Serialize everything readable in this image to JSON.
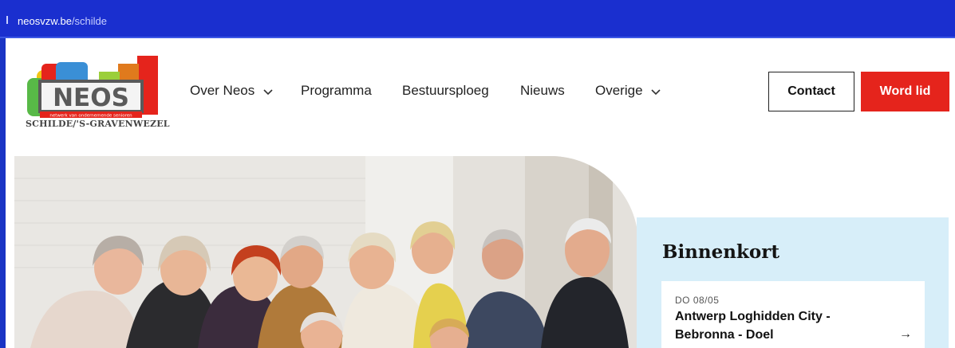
{
  "browser": {
    "url_host": "neosvzw.be",
    "url_path": "/schilde"
  },
  "brand": {
    "logo_text": "NEOS",
    "logo_subtext": "netwerk van ondernemende senioren",
    "tagline": "SCHILDE/'S-GRAVENWEZEL"
  },
  "nav": {
    "items": [
      {
        "label": "Over Neos",
        "has_dropdown": true
      },
      {
        "label": "Programma",
        "has_dropdown": false
      },
      {
        "label": "Bestuursploeg",
        "has_dropdown": false
      },
      {
        "label": "Nieuws",
        "has_dropdown": false
      },
      {
        "label": "Overige",
        "has_dropdown": true
      }
    ],
    "contact_label": "Contact",
    "join_label": "Word lid"
  },
  "upcoming": {
    "title": "Binnenkort",
    "events": [
      {
        "date": "DO 08/05",
        "title": "Antwerp Loghidden City - Bebronna - Doel"
      }
    ]
  },
  "colors": {
    "accent_red": "#e5241c",
    "panel_blue": "#d7eef9",
    "browser_blue": "#1a2fcf"
  }
}
